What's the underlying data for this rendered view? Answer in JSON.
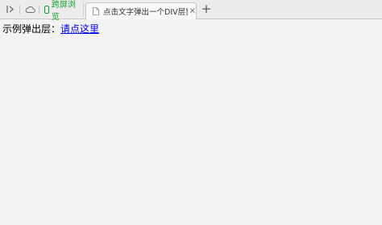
{
  "tabbar": {
    "special_tab_label": "跨屏浏览",
    "active_tab_title": "点击文字弹出一个DIV层窗口代",
    "close_glyph": "×",
    "new_tab_glyph": "+"
  },
  "page": {
    "intro_text": "示例弹出层：",
    "link_text": "请点这里"
  },
  "colors": {
    "background": "#f2f2f2",
    "special_tab": "#14a02e",
    "link": "#0000ee"
  }
}
